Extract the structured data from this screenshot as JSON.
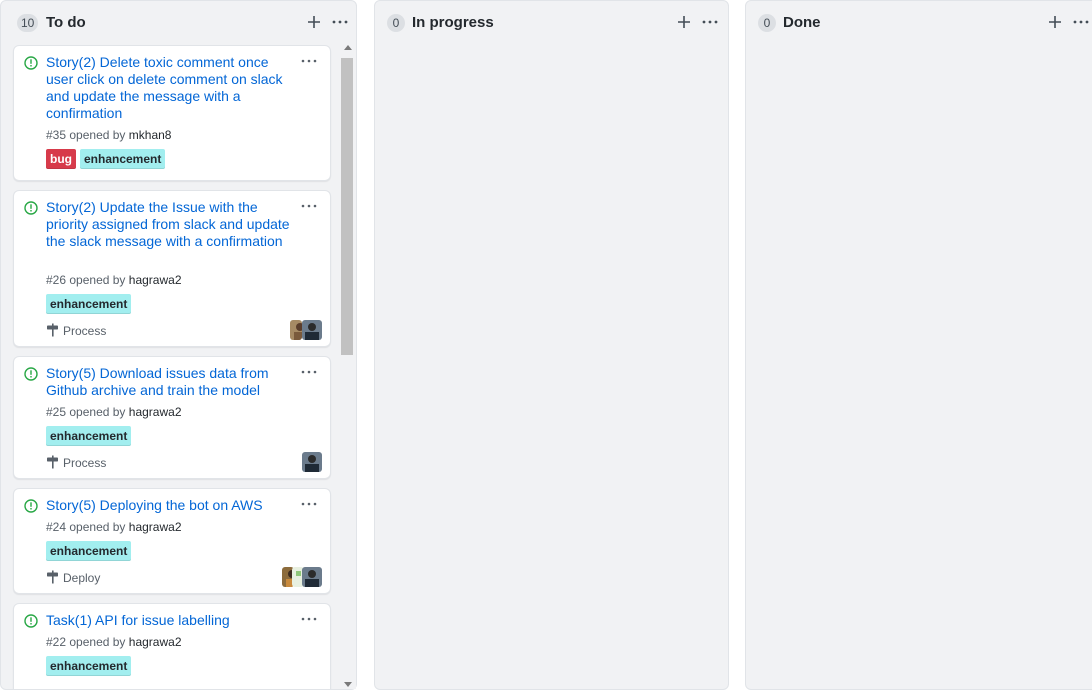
{
  "columns": [
    {
      "count": "10",
      "title": "To do",
      "cards": [
        {
          "title": "Story(2) Delete toxic comment once user click on delete comment on slack and update the message with a confirmation",
          "number": "#35",
          "opened_by": "opened by",
          "author": "mkhan8",
          "labels": [
            "bug",
            "enhancement"
          ],
          "milestone": "",
          "avatars": []
        },
        {
          "title": "Story(2) Update the Issue with the priority assigned from slack and update the slack message with a confirmation",
          "number": "#26",
          "opened_by": "opened by",
          "author": "hagrawa2",
          "labels": [
            "enhancement"
          ],
          "milestone": "Process",
          "avatars": [
            "avatar-1",
            "avatar-2"
          ]
        },
        {
          "title": "Story(5) Download issues data from Github archive and train the model",
          "number": "#25",
          "opened_by": "opened by",
          "author": "hagrawa2",
          "labels": [
            "enhancement"
          ],
          "milestone": "Process",
          "avatars": [
            "avatar-2"
          ]
        },
        {
          "title": "Story(5) Deploying the bot on AWS",
          "number": "#24",
          "opened_by": "opened by",
          "author": "hagrawa2",
          "labels": [
            "enhancement"
          ],
          "milestone": "Deploy",
          "avatars": [
            "avatar-3",
            "avatar-4",
            "avatar-2"
          ]
        },
        {
          "title": "Task(1) API for issue labelling",
          "number": "#22",
          "opened_by": "opened by",
          "author": "hagrawa2",
          "labels": [
            "enhancement"
          ],
          "milestone": "",
          "avatars": []
        }
      ]
    },
    {
      "count": "0",
      "title": "In progress",
      "cards": []
    },
    {
      "count": "0",
      "title": "Done",
      "cards": []
    }
  ],
  "icons": {
    "add": "plus-icon",
    "more": "kebab-horizontal-icon",
    "issue": "issue-opened-icon",
    "milestone": "milestone-icon"
  },
  "colors": {
    "link": "#0366d6",
    "issue_open": "#28a745",
    "bug_label": "#d73a4a",
    "enhancement_label": "#a2eeef",
    "column_bg": "#f1f2f4"
  }
}
